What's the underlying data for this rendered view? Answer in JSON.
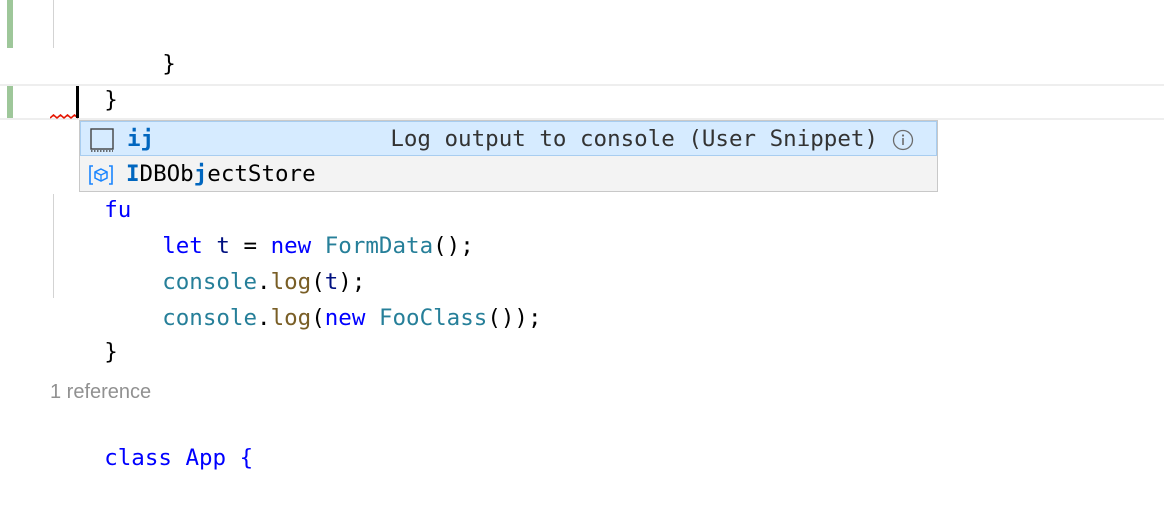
{
  "editor": {
    "lines": {
      "close_inner": "}",
      "close_outer": "}",
      "typed": "ij",
      "fn_prefix": "fu",
      "let_kw": "let",
      "let_var": "t",
      "let_eq": " = ",
      "new_kw": "new",
      "formdata_type": "FormData",
      "let_end": "();",
      "console1": "console",
      "dot1": ".",
      "log1": "log",
      "args1_open": "(",
      "args1_var": "t",
      "args1_close": ");",
      "console2": "console",
      "dot2": ".",
      "log2": "log",
      "args2_open": "(",
      "new2_kw": "new",
      "fooclass_type": "FooClass",
      "args2_close": "());",
      "close_fn": "}",
      "class_line": "class App {"
    },
    "codelens": "1 reference"
  },
  "suggest": {
    "items": [
      {
        "label_match": "ij",
        "label_rest": "",
        "detail": "Log output to console (User Snippet)",
        "icon": "snippet-icon",
        "selected": true
      },
      {
        "label_match_1": "I",
        "label_mid_1": "DBOb",
        "label_match_2": "j",
        "label_rest": "ectStore",
        "icon": "interface-icon"
      }
    ]
  },
  "colors": {
    "keyword": "#0000ff",
    "type": "#267f99",
    "variable": "#001080",
    "function": "#795e26",
    "match": "#0066bf",
    "selected_bg": "#d6ebff",
    "gutter_modified": "#9ec79a"
  }
}
